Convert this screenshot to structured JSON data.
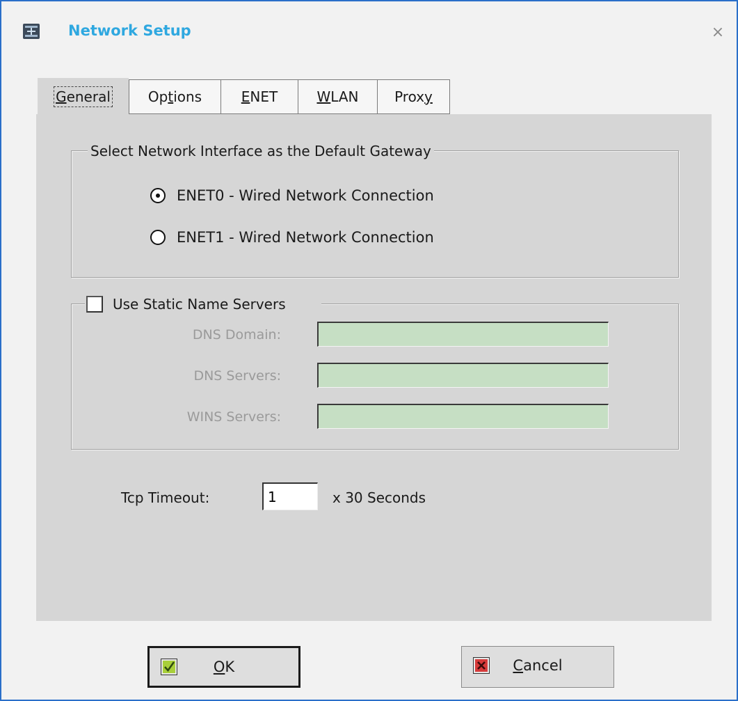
{
  "window": {
    "title": "Network Setup",
    "icon": "network-icon",
    "close_icon": "close-icon",
    "close_glyph": "×"
  },
  "tabs": [
    {
      "label": "General",
      "mnemonic": "G",
      "rest": "eneral",
      "active": true
    },
    {
      "label": "Options",
      "pre": "Op",
      "mnemonic": "t",
      "rest": "ions",
      "active": false
    },
    {
      "label": "ENET",
      "mnemonic": "E",
      "rest": "NET",
      "active": false
    },
    {
      "label": "WLAN",
      "mnemonic": "W",
      "rest": "LAN",
      "active": false
    },
    {
      "label": "Proxy",
      "pre": "Prox",
      "mnemonic": "y",
      "rest": "",
      "active": false
    }
  ],
  "gateway_group": {
    "title": "Select Network Interface as the Default Gateway",
    "options": [
      {
        "label": "ENET0 - Wired Network Connection",
        "selected": true
      },
      {
        "label": "ENET1 - Wired Network Connection",
        "selected": false
      }
    ]
  },
  "dns_group": {
    "checkbox_label": "Use Static Name Servers",
    "checked": false,
    "fields": [
      {
        "label": "DNS Domain:",
        "value": ""
      },
      {
        "label": "DNS Servers:",
        "value": ""
      },
      {
        "label": "WINS Servers:",
        "value": ""
      }
    ],
    "field_color": "#c6dfc4"
  },
  "tcp": {
    "label": "Tcp Timeout:",
    "value": "1",
    "suffix": "x  30 Seconds"
  },
  "buttons": {
    "ok": {
      "mnemonic": "O",
      "rest": "K",
      "icon": "checkmark-icon"
    },
    "cancel": {
      "mnemonic": "C",
      "rest": "ancel",
      "icon": "x-mark-icon"
    }
  },
  "colors": {
    "accent": "#2fa8e0",
    "window_border": "#2a6fc9",
    "panel": "#d6d6d6"
  }
}
